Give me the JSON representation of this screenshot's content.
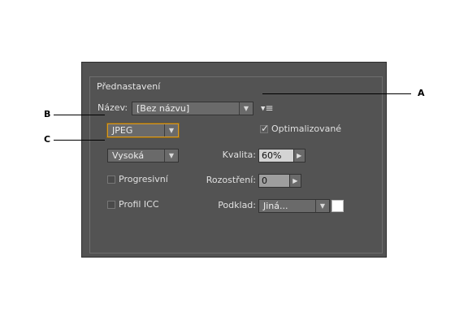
{
  "group_title": "Přednastavení",
  "preset": {
    "label": "Název:",
    "value": "[Bez názvu]"
  },
  "format": {
    "value": "JPEG"
  },
  "optimized": {
    "label": "Optimalizované",
    "checked": true
  },
  "quality_preset": {
    "value": "Vysoká"
  },
  "quality": {
    "label": "Kvalita:",
    "value": "60%"
  },
  "progressive": {
    "label": "Progresivní",
    "checked": false
  },
  "blur": {
    "label": "Rozostření:",
    "value": "0"
  },
  "icc": {
    "label": "Profil ICC",
    "checked": false
  },
  "matte": {
    "label": "Podklad:",
    "value": "Jiná...",
    "swatch_color": "#ffffff"
  },
  "callouts": {
    "a": "A",
    "b": "B",
    "c": "C"
  },
  "icons": {
    "dropdown_arrow": "▼",
    "stepper_arrow": "▶",
    "checkmark": "✓",
    "panel_menu": "≡"
  }
}
